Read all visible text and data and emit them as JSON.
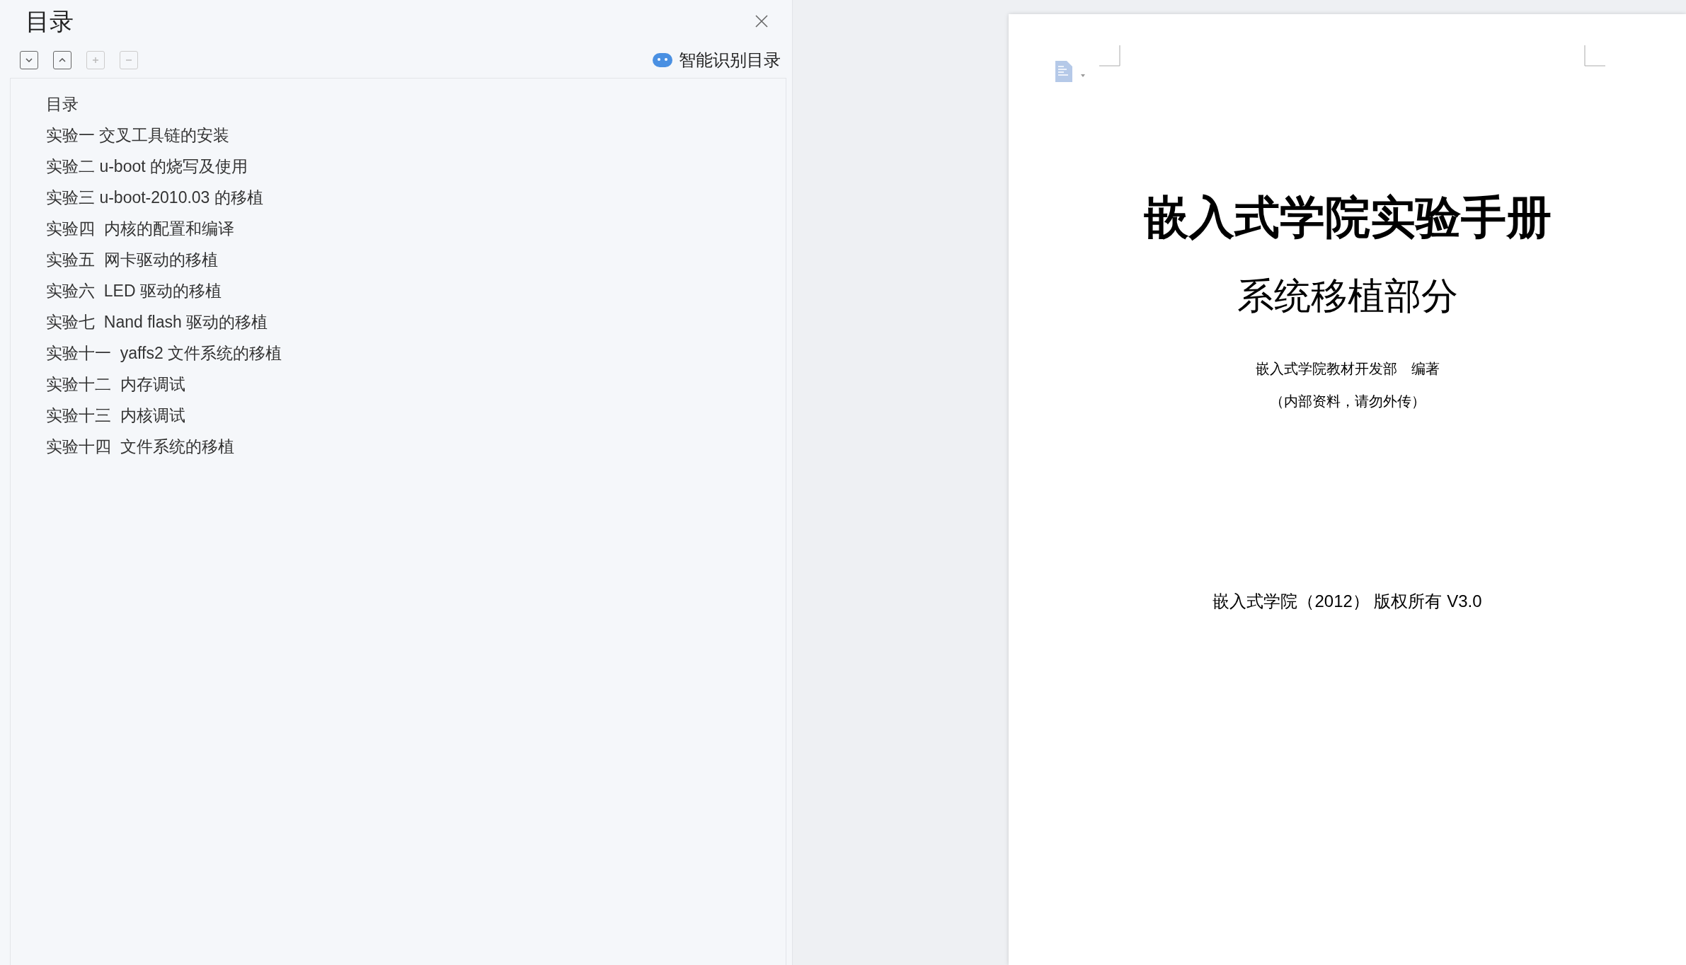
{
  "panel": {
    "title": "目录",
    "tools": [
      {
        "kind": "expand",
        "disabled": false
      },
      {
        "kind": "collapse",
        "disabled": false
      },
      {
        "kind": "plus",
        "disabled": true
      },
      {
        "kind": "minus",
        "disabled": true
      }
    ],
    "smart_button": "智能识别目录"
  },
  "toc": [
    "目录",
    "实验一 交叉工具链的安装",
    "实验二 u-boot 的烧写及使用",
    "实验三 u-boot-2010.03 的移植",
    "实验四  内核的配置和编译",
    "实验五  网卡驱动的移植",
    "实验六  LED 驱动的移植",
    "实验七  Nand flash 驱动的移植",
    "实验十一  yaffs2 文件系统的移植",
    "实验十二  内存调试",
    "实验十三  内核调试",
    "实验十四  文件系统的移植"
  ],
  "document": {
    "title": "嵌入式学院实验手册",
    "subtitle": "系统移植部分",
    "author": "嵌入式学院教材开发部　编著",
    "note": "（内部资料，请勿外传）",
    "copyright": "嵌入式学院（2012） 版权所有 V3.0"
  }
}
